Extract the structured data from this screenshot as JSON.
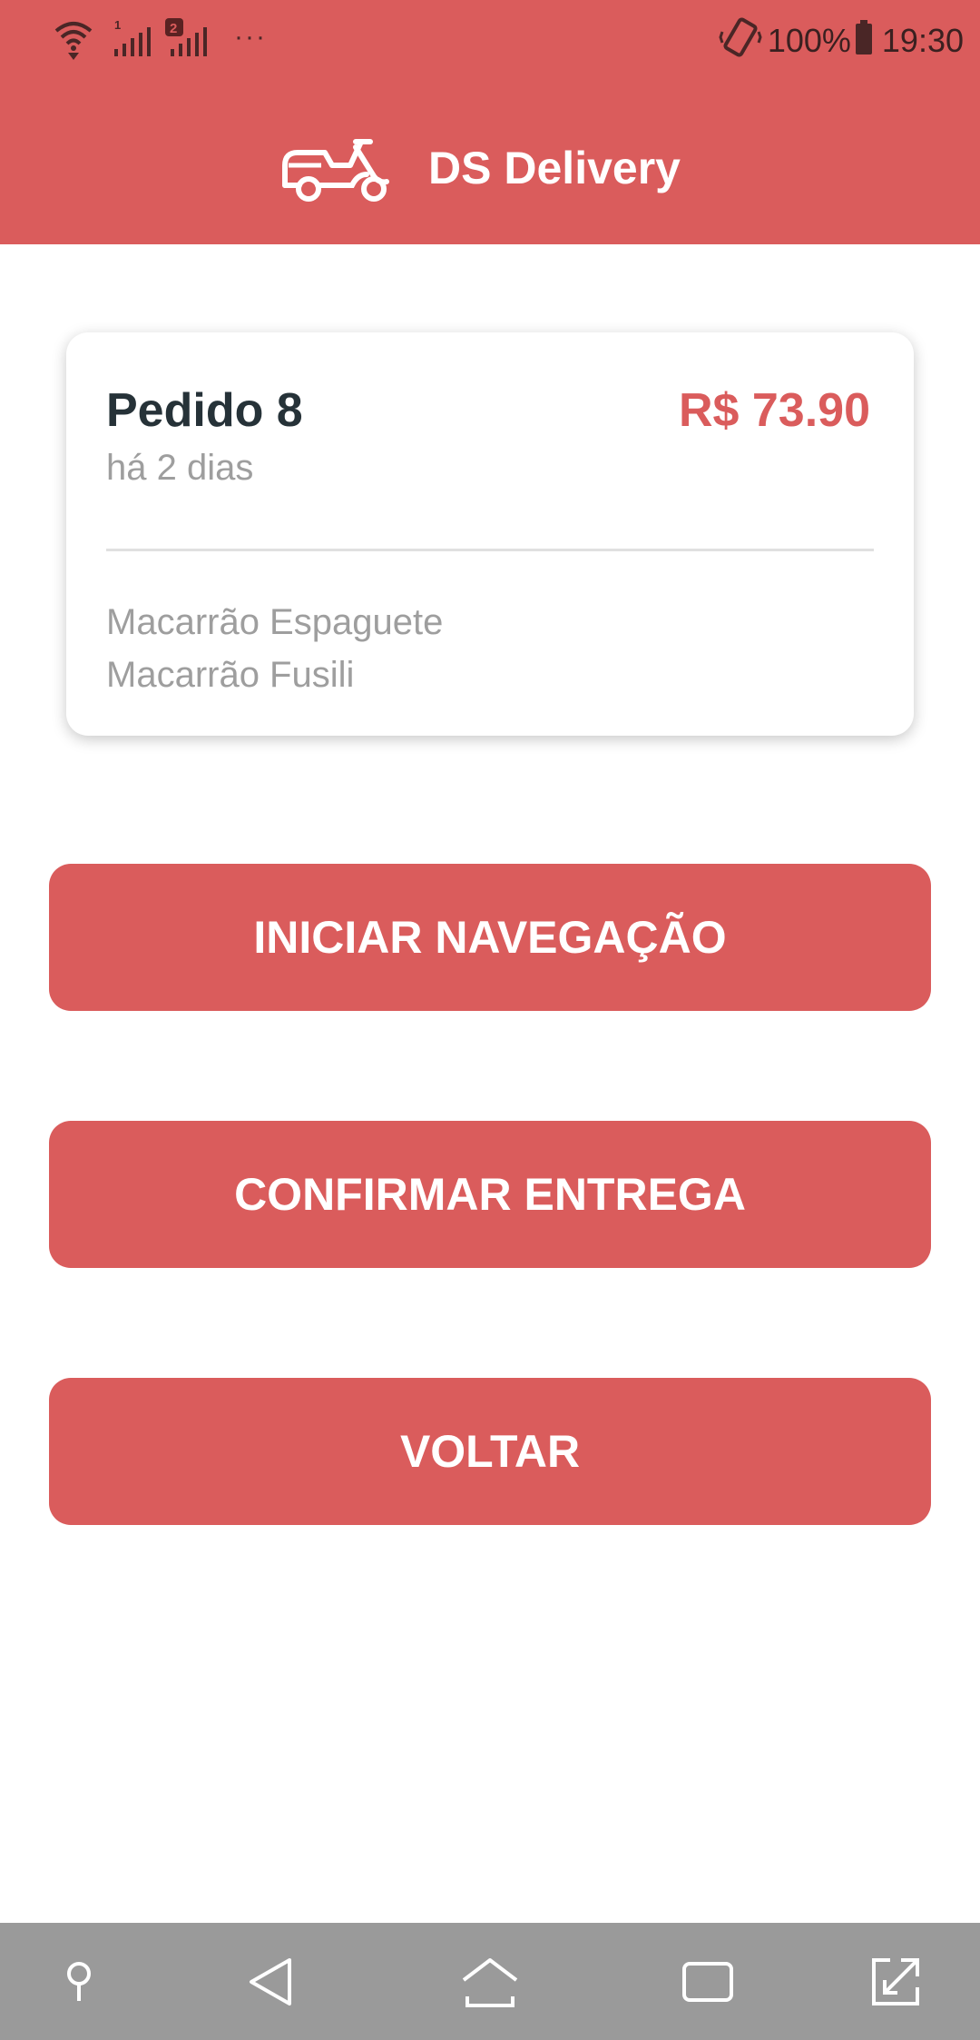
{
  "status_bar": {
    "overflow_dots": "···",
    "battery_percent": "100%",
    "time": "19:30",
    "sim1_label": "1",
    "sim2_badge": "2"
  },
  "header": {
    "title": "DS Delivery",
    "logo_icon": "scooter-icon"
  },
  "order": {
    "name": "Pedido 8",
    "price": "R$ 73.90",
    "time_ago": "há 2 dias",
    "products": [
      "Macarrão Espaguete",
      "Macarrão Fusili"
    ]
  },
  "buttons": {
    "start_navigation": "INICIAR NAVEGAÇÃO",
    "confirm_delivery": "CONFIRMAR ENTREGA",
    "back": "VOLTAR"
  },
  "nav_bar": {
    "icons": [
      "pin-icon",
      "back-icon",
      "home-icon",
      "recents-icon",
      "expand-icon"
    ]
  },
  "colors": {
    "primary": "#DA5C5C",
    "dark_text": "#263238",
    "muted_text": "#9E9E9E",
    "nav_bar": "#9A9A9A"
  }
}
